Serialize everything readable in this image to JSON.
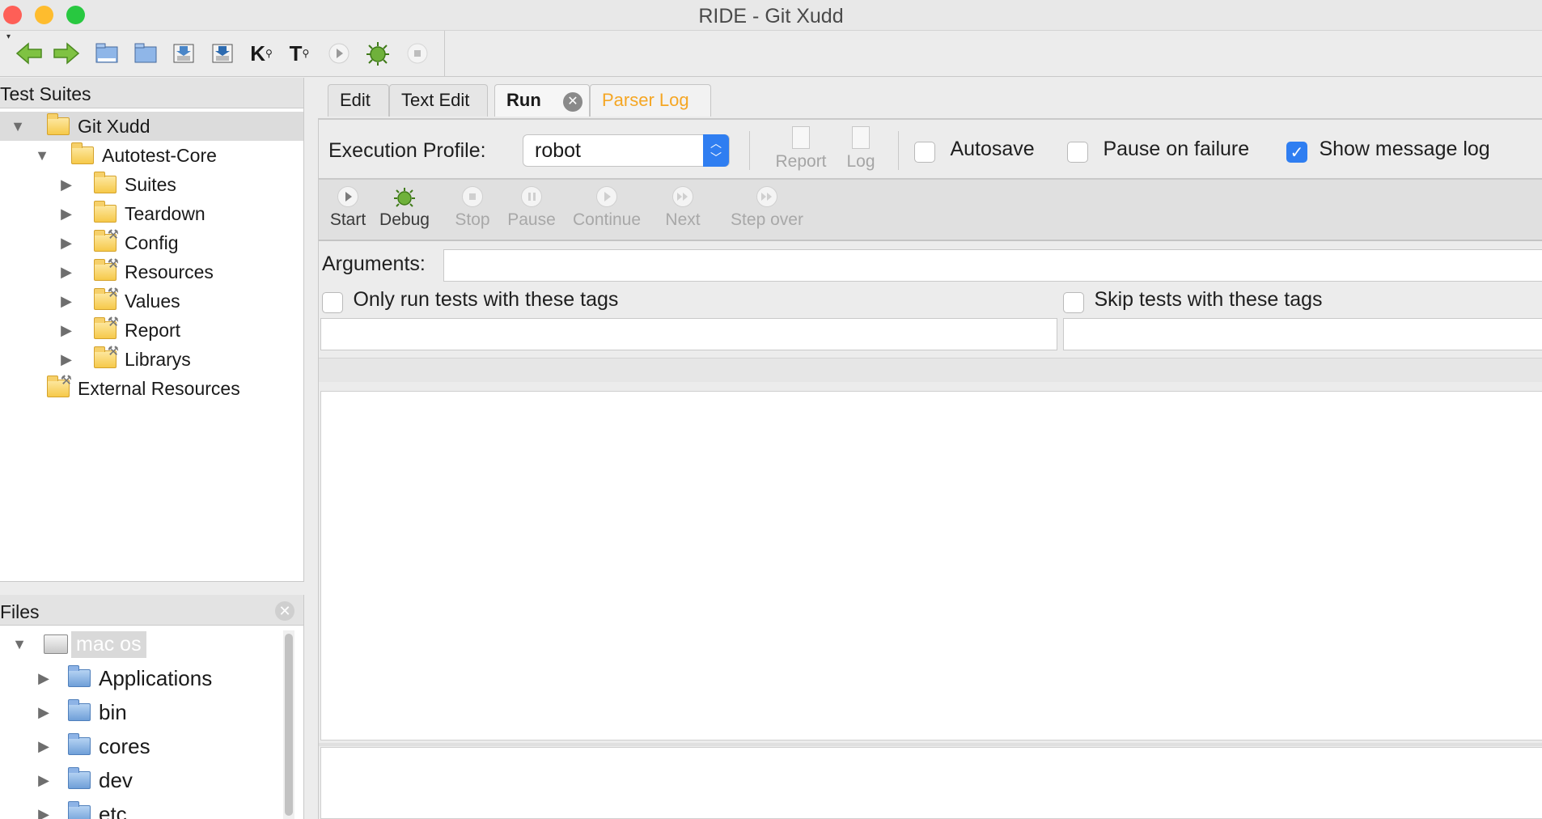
{
  "window": {
    "title": "RIDE - Git Xudd",
    "traffic_colors": [
      "#fe5f57",
      "#febc2e",
      "#28c840"
    ]
  },
  "toolbar": {
    "buttons": [
      "back-icon",
      "forward-icon",
      "open-test-suite-icon",
      "open-directory-icon",
      "save-icon",
      "save-all-icon",
      "search-keywords-icon",
      "search-tests-icon",
      "run-icon",
      "debug-icon",
      "stop-icon"
    ]
  },
  "suites_pane": {
    "title": "Test Suites",
    "root": "Git Xudd",
    "project": "Autotest-Core",
    "children": [
      "Suites",
      "Teardown",
      "Config",
      "Resources",
      "Values",
      "Report",
      "Librarys"
    ],
    "external": "External Resources"
  },
  "files_pane": {
    "title": "Files",
    "root": "mac os",
    "items": [
      "Applications",
      "bin",
      "cores",
      "dev",
      "etc"
    ]
  },
  "tabs": {
    "edit": "Edit",
    "text_edit": "Text Edit",
    "run": "Run",
    "parser_log": "Parser Log"
  },
  "run": {
    "execution_profile_label": "Execution Profile:",
    "execution_profile_value": "robot",
    "report_label": "Report",
    "log_label": "Log",
    "autosave_label": "Autosave",
    "pause_on_failure_label": "Pause on failure",
    "show_message_log_label": "Show message log",
    "show_message_log_checked": true,
    "controls": {
      "start": "Start",
      "debug": "Debug",
      "stop": "Stop",
      "pause": "Pause",
      "continue": "Continue",
      "next": "Next",
      "step_over": "Step over"
    },
    "arguments_label": "Arguments:",
    "arguments_value": "",
    "only_run_tags_label": "Only run tests with these tags",
    "skip_tags_label": "Skip tests with these tags"
  }
}
